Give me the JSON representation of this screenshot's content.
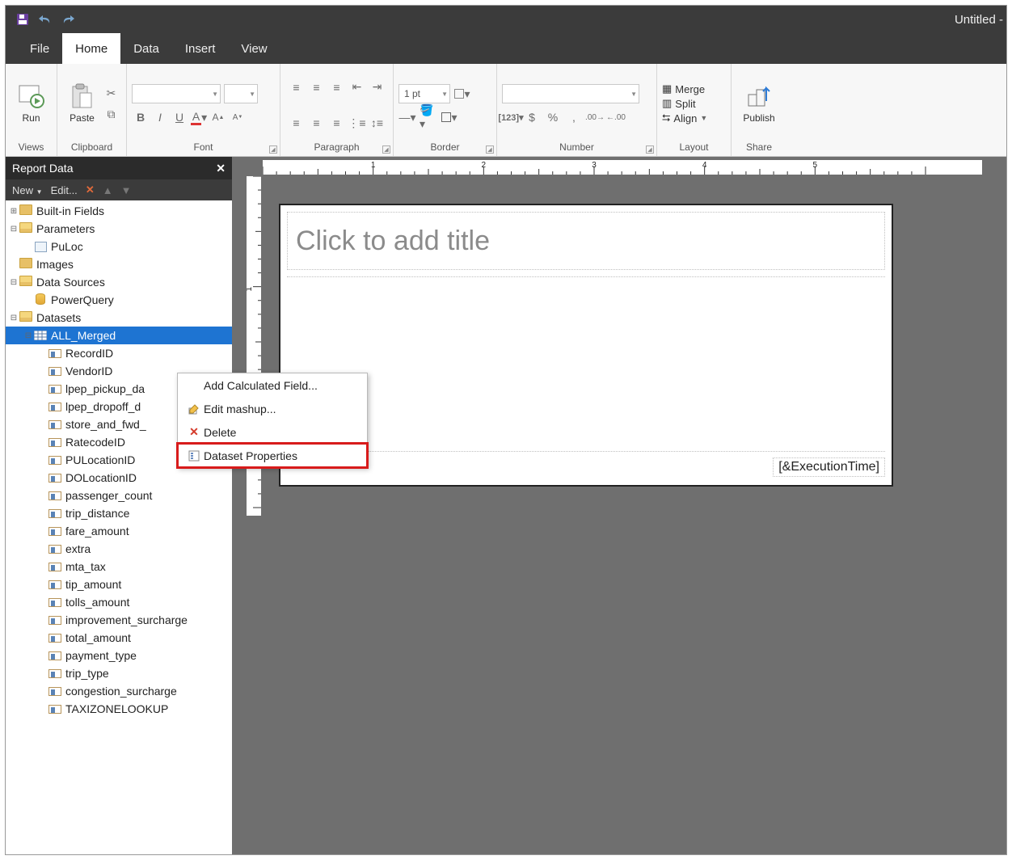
{
  "document_title": "Untitled -",
  "menubar": {
    "file": "File",
    "home": "Home",
    "data": "Data",
    "insert": "Insert",
    "view": "View",
    "active": "home"
  },
  "qat": {
    "save": "save",
    "undo": "undo",
    "redo": "redo"
  },
  "ribbon": {
    "views": {
      "label": "Views",
      "run": "Run"
    },
    "clipboard": {
      "label": "Clipboard",
      "paste": "Paste"
    },
    "font": {
      "label": "Font",
      "bold": "B",
      "italic": "I",
      "underline": "U",
      "font_name": "",
      "font_size": ""
    },
    "paragraph": {
      "label": "Paragraph"
    },
    "border": {
      "label": "Border",
      "weight": "1 pt"
    },
    "number": {
      "label": "Number",
      "format": ""
    },
    "layout": {
      "label": "Layout",
      "merge": "Merge",
      "split": "Split",
      "align": "Align"
    },
    "share": {
      "label": "Share",
      "publish": "Publish"
    }
  },
  "panel": {
    "title": "Report Data",
    "toolbar": {
      "new": "New",
      "edit": "Edit..."
    },
    "nodes": [
      {
        "depth": 0,
        "expander": "+",
        "icon": "folder-closed",
        "label": "Built-in Fields"
      },
      {
        "depth": 0,
        "expander": "-",
        "icon": "folder-open",
        "label": "Parameters"
      },
      {
        "depth": 1,
        "expander": "",
        "icon": "param",
        "label": "PuLoc"
      },
      {
        "depth": 0,
        "expander": "",
        "icon": "folder-closed",
        "label": "Images"
      },
      {
        "depth": 0,
        "expander": "-",
        "icon": "folder-open",
        "label": "Data Sources"
      },
      {
        "depth": 1,
        "expander": "",
        "icon": "db",
        "label": "PowerQuery"
      },
      {
        "depth": 0,
        "expander": "-",
        "icon": "folder-open",
        "label": "Datasets"
      },
      {
        "depth": 1,
        "expander": "-",
        "icon": "table",
        "label": "ALL_Merged",
        "selected": true
      },
      {
        "depth": 2,
        "expander": "",
        "icon": "field",
        "label": "RecordID"
      },
      {
        "depth": 2,
        "expander": "",
        "icon": "field",
        "label": "VendorID"
      },
      {
        "depth": 2,
        "expander": "",
        "icon": "field",
        "label": "lpep_pickup_da"
      },
      {
        "depth": 2,
        "expander": "",
        "icon": "field",
        "label": "lpep_dropoff_d"
      },
      {
        "depth": 2,
        "expander": "",
        "icon": "field",
        "label": "store_and_fwd_"
      },
      {
        "depth": 2,
        "expander": "",
        "icon": "field",
        "label": "RatecodeID"
      },
      {
        "depth": 2,
        "expander": "",
        "icon": "field",
        "label": "PULocationID"
      },
      {
        "depth": 2,
        "expander": "",
        "icon": "field",
        "label": "DOLocationID"
      },
      {
        "depth": 2,
        "expander": "",
        "icon": "field",
        "label": "passenger_count"
      },
      {
        "depth": 2,
        "expander": "",
        "icon": "field",
        "label": "trip_distance"
      },
      {
        "depth": 2,
        "expander": "",
        "icon": "field",
        "label": "fare_amount"
      },
      {
        "depth": 2,
        "expander": "",
        "icon": "field",
        "label": "extra"
      },
      {
        "depth": 2,
        "expander": "",
        "icon": "field",
        "label": "mta_tax"
      },
      {
        "depth": 2,
        "expander": "",
        "icon": "field",
        "label": "tip_amount"
      },
      {
        "depth": 2,
        "expander": "",
        "icon": "field",
        "label": "tolls_amount"
      },
      {
        "depth": 2,
        "expander": "",
        "icon": "field",
        "label": "improvement_surcharge"
      },
      {
        "depth": 2,
        "expander": "",
        "icon": "field",
        "label": "total_amount"
      },
      {
        "depth": 2,
        "expander": "",
        "icon": "field",
        "label": "payment_type"
      },
      {
        "depth": 2,
        "expander": "",
        "icon": "field",
        "label": "trip_type"
      },
      {
        "depth": 2,
        "expander": "",
        "icon": "field",
        "label": "congestion_surcharge"
      },
      {
        "depth": 2,
        "expander": "",
        "icon": "field",
        "label": "TAXIZONELOOKUP"
      }
    ]
  },
  "context_menu": [
    {
      "icon": "",
      "label": "Add Calculated Field..."
    },
    {
      "icon": "edit",
      "label": "Edit mashup..."
    },
    {
      "icon": "delete",
      "label": "Delete"
    },
    {
      "icon": "props",
      "label": "Dataset Properties"
    }
  ],
  "canvas": {
    "title_placeholder": "Click to add title",
    "footer_field": "[&ExecutionTime]",
    "ruler_numbers": [
      "1",
      "2",
      "3",
      "4",
      "5"
    ],
    "vruler_numbers": [
      "1"
    ]
  }
}
